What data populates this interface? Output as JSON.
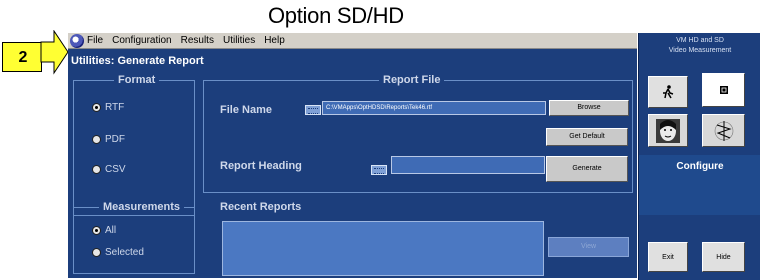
{
  "caption": "Option SD/HD",
  "callout": {
    "number": "2"
  },
  "menubar": {
    "items": [
      "File",
      "Configuration",
      "Results",
      "Utilities",
      "Help"
    ]
  },
  "title": "Utilities: Generate Report",
  "format": {
    "title": "Format",
    "options": [
      {
        "label": "RTF",
        "selected": true
      },
      {
        "label": "PDF",
        "selected": false
      },
      {
        "label": "CSV",
        "selected": false
      }
    ]
  },
  "measurements": {
    "title": "Measurements",
    "options": [
      {
        "label": "All",
        "selected": true
      },
      {
        "label": "Selected",
        "selected": false
      }
    ]
  },
  "report_file": {
    "title": "Report File",
    "file_name_label": "File Name",
    "file_name_value": "C:\\VMApps\\OptHDSD\\Reports\\Tek46.rtf",
    "browse_label": "Browse",
    "get_default_label": "Get Default",
    "heading_label": "Report Heading",
    "heading_value": "",
    "generate_label": "Generate"
  },
  "recent": {
    "title": "Recent Reports",
    "view_label": "View"
  },
  "panel": {
    "header_line1": "VM HD and SD",
    "header_line2": "Video Measurement",
    "configure_label": "Configure",
    "exit_label": "Exit",
    "hide_label": "Hide"
  }
}
